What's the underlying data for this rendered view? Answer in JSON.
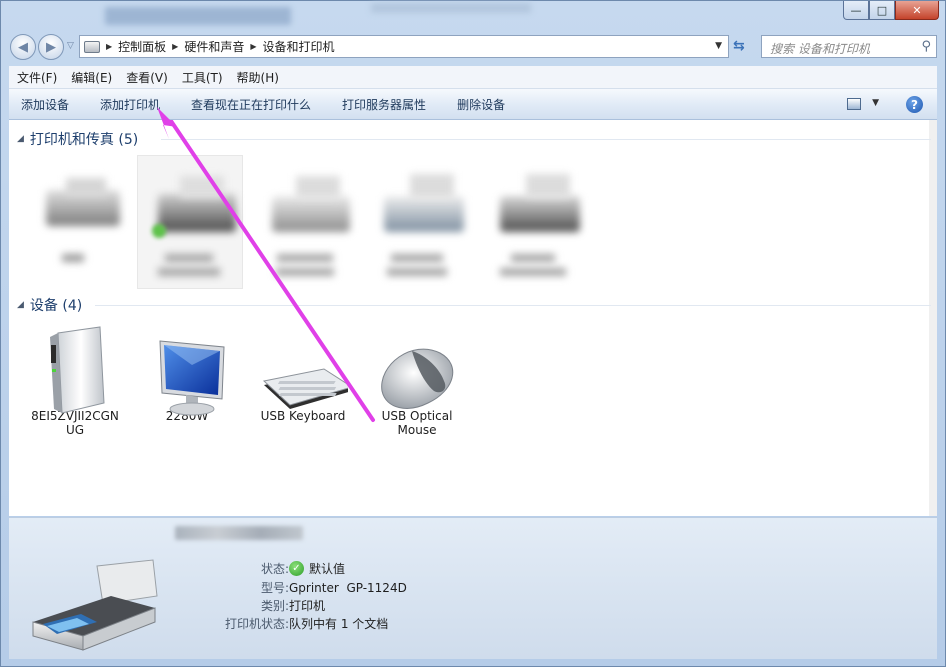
{
  "window": {
    "buttons": {
      "minimize": "—",
      "maximize": "□",
      "close": "✕"
    }
  },
  "address": {
    "path": [
      "控制面板",
      "硬件和声音",
      "设备和打印机"
    ],
    "search_placeholder": "搜索 设备和打印机"
  },
  "menu": [
    "文件(F)",
    "编辑(E)",
    "查看(V)",
    "工具(T)",
    "帮助(H)"
  ],
  "toolbar": [
    "添加设备",
    "添加打印机",
    "查看现在正在打印什么",
    "打印服务器属性",
    "删除设备"
  ],
  "groups": {
    "printers": {
      "title": "打印机和传真 (5)"
    },
    "devices": {
      "title": "设备 (4)"
    }
  },
  "devices": [
    {
      "label_line1": "8EI5ZVJII2CGN",
      "label_line2": "UG",
      "icon": "computer-tower-icon"
    },
    {
      "label_line1": "2280W",
      "label_line2": "",
      "icon": "monitor-icon"
    },
    {
      "label_line1": "USB Keyboard",
      "label_line2": "",
      "icon": "keyboard-icon"
    },
    {
      "label_line1": "USB Optical",
      "label_line2": "Mouse",
      "icon": "mouse-icon"
    }
  ],
  "details": {
    "status_key": "状态:",
    "status_value": "默认值",
    "model_key": "型号:",
    "model_value": "Gprinter  GP-1124D",
    "category_key": "类别:",
    "category_value": "打印机",
    "printer_status_key": "打印机状态:",
    "printer_status_value": "队列中有 1 个文档"
  },
  "colors": {
    "accent_arrow": "#e040e8",
    "group_header": "#1e3f6d"
  }
}
